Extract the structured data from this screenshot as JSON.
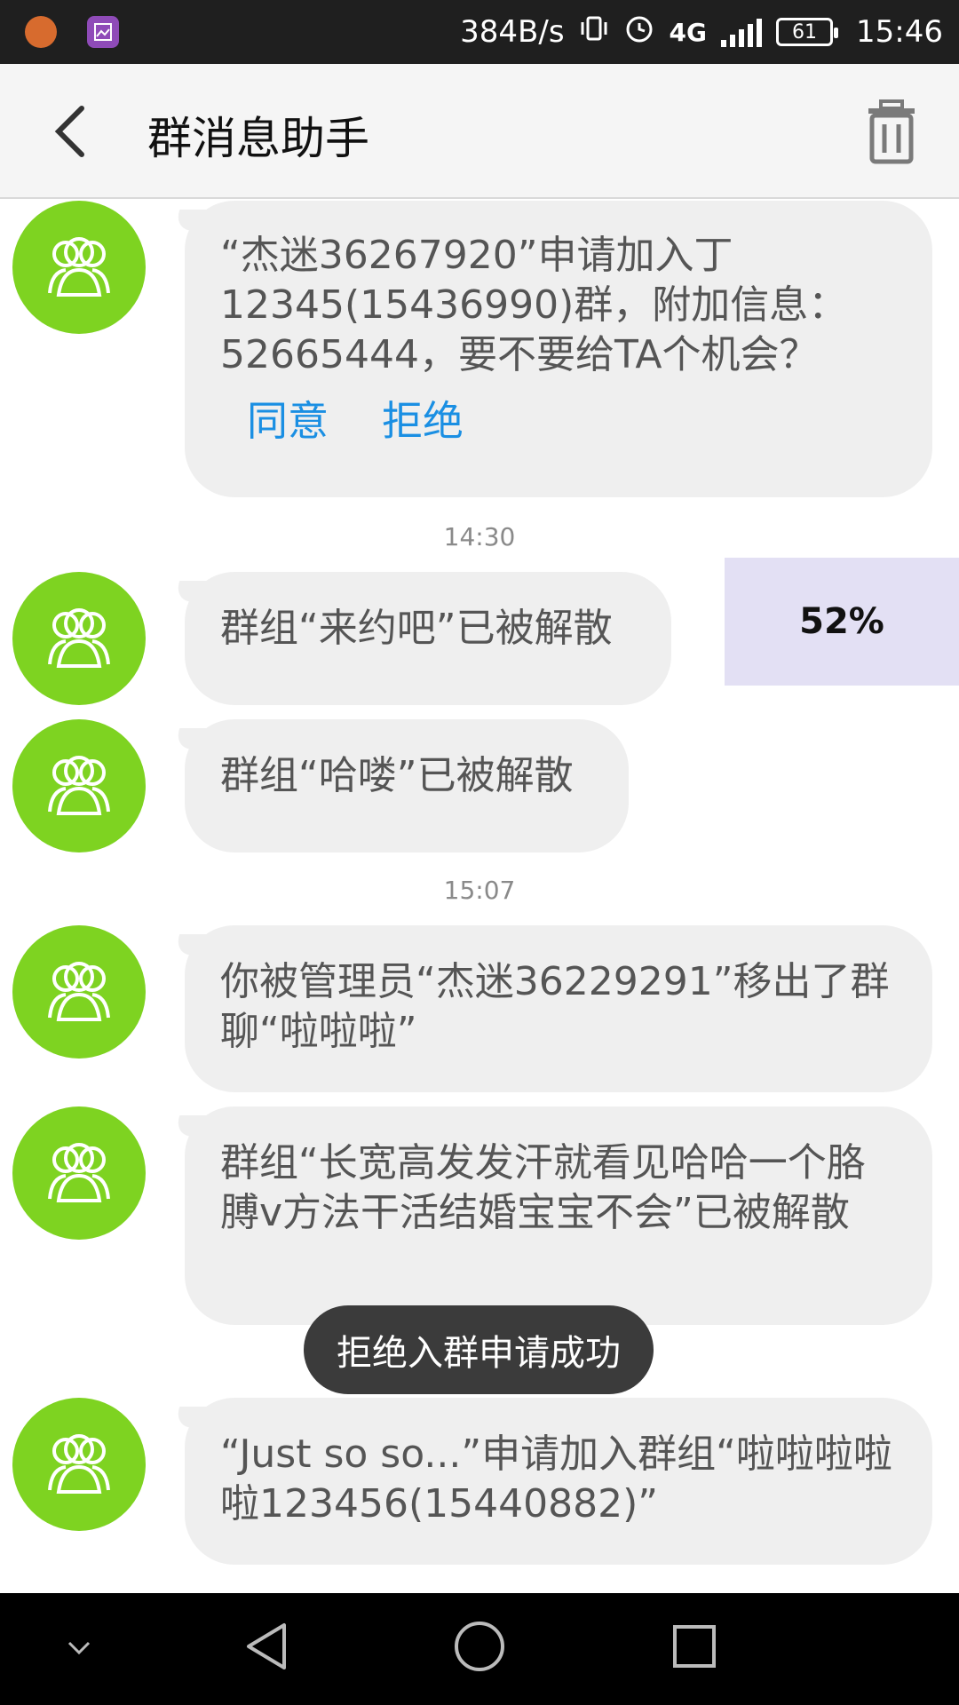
{
  "status_bar": {
    "speed": "384B/s",
    "network": "4G",
    "battery": "61",
    "time": "15:46"
  },
  "header": {
    "title": "群消息助手"
  },
  "messages": [
    {
      "text": "“杰迷36267920”申请加入丁12345(15436990)群，附加信息：52665444，要不要给TA个机会？",
      "agree": "同意",
      "reject": "拒绝"
    },
    {
      "timestamp": "14:30"
    },
    {
      "text": "群组“来约吧”已被解散"
    },
    {
      "text": "群组“哈喽”已被解散"
    },
    {
      "timestamp": "15:07"
    },
    {
      "text": "你被管理员“杰迷36229291”移出了群聊“啦啦啦”"
    },
    {
      "text": "群组“长宽高发发汗就看见哈哈一个胳膊v方法干活结婚宝宝不会”已被解散"
    },
    {
      "text": "“Just so so...”申请加入群组“啦啦啦啦啦123456(15440882)”"
    }
  ],
  "progress_overlay": {
    "label": "52%"
  },
  "toast": {
    "text": "拒绝入群申请成功"
  },
  "colors": {
    "avatar": "#7ed321",
    "link": "#1a8fe3",
    "bubble": "#efefef"
  }
}
